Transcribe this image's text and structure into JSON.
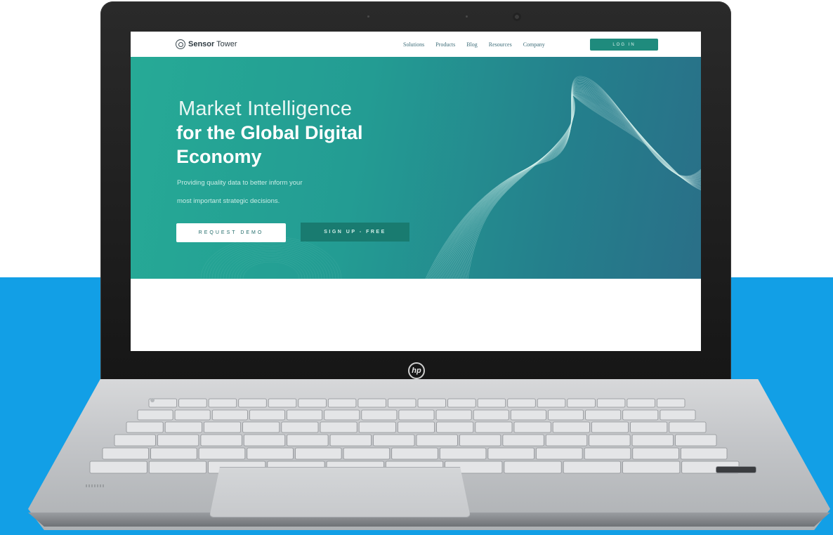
{
  "colors": {
    "background_band": "#129fe6",
    "hero_gradient_start": "#26aa96",
    "hero_gradient_end": "#2a6f88",
    "login_button": "#1f8b7d",
    "signup_button": "#197b70",
    "laptop_bezel": "#1c1c1c",
    "laptop_body": "#c8cacd"
  },
  "laptop": {
    "brand_logo_text": "hp",
    "brand_icon": "hp-logo-icon"
  },
  "site": {
    "logo": {
      "icon": "sensor-tower-logo-icon",
      "name_bold": "Sensor",
      "name_light": " Tower"
    },
    "nav": {
      "links": [
        "Solutions",
        "Products",
        "Blog",
        "Resources",
        "Company"
      ],
      "login_label": "LOG IN"
    },
    "hero": {
      "title_light": "Market Intelligence",
      "title_bold_1": "for the Global Digital",
      "title_bold_2": "Economy",
      "subtitle_1": "Providing quality data to better inform your",
      "subtitle_2": "most important strategic decisions.",
      "cta_primary": "REQUEST DEMO",
      "cta_secondary": "SIGN UP - FREE",
      "decoration": "wave-lines-graphic"
    }
  }
}
